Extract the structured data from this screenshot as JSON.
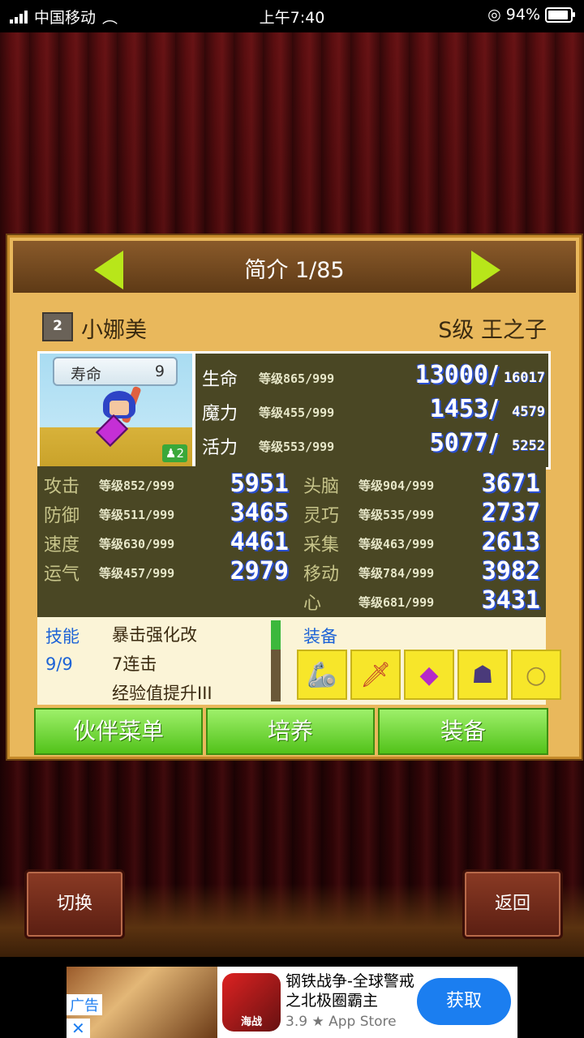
{
  "statusbar": {
    "carrier": "中国移动",
    "time": "上午7:40",
    "battery": "94%"
  },
  "panel": {
    "title": "简介 1/85",
    "rank_number": "2",
    "name": "小娜美",
    "class_title": "S级 王之子",
    "lifespan_label": "寿命",
    "lifespan_value": "9",
    "companion_level": "2"
  },
  "vitals": [
    {
      "label": "生命",
      "level": "等级865/999",
      "current": "13000",
      "max": "16017"
    },
    {
      "label": "魔力",
      "level": "等级455/999",
      "current": "1453",
      "max": "4579"
    },
    {
      "label": "活力",
      "level": "等级553/999",
      "current": "5077",
      "max": "5252"
    }
  ],
  "stats": [
    {
      "label": "攻击",
      "level": "等级852/999",
      "value": "5951"
    },
    {
      "label": "防御",
      "level": "等级511/999",
      "value": "3465"
    },
    {
      "label": "速度",
      "level": "等级630/999",
      "value": "4461"
    },
    {
      "label": "运气",
      "level": "等级457/999",
      "value": "2979"
    },
    {
      "label": "头脑",
      "level": "等级904/999",
      "value": "3671"
    },
    {
      "label": "灵巧",
      "level": "等级535/999",
      "value": "2737"
    },
    {
      "label": "采集",
      "level": "等级463/999",
      "value": "2613"
    },
    {
      "label": "移动",
      "level": "等级784/999",
      "value": "3982"
    },
    {
      "label": "心",
      "level": "等级681/999",
      "value": "3431"
    }
  ],
  "skills": {
    "label": "技能",
    "count": "9/9",
    "items": [
      "暴击强化改",
      "7连击",
      "经验值提升III"
    ]
  },
  "equipment": {
    "label": "装备",
    "items": [
      "gauntlet-icon",
      "sword-icon",
      "gem-icon",
      "hood-icon",
      "necklace-icon"
    ]
  },
  "buttons": {
    "partner_menu": "伙伴菜单",
    "train": "培养",
    "equip": "装备"
  },
  "bottom": {
    "switch": "切换",
    "back": "返回"
  },
  "ad": {
    "tag": "广告",
    "close": "✕",
    "app_icon_text": "海战",
    "title": "钢铁战争-全球警戒之北极圈霸主",
    "rating": "3.9 ★ App Store",
    "get": "获取"
  }
}
